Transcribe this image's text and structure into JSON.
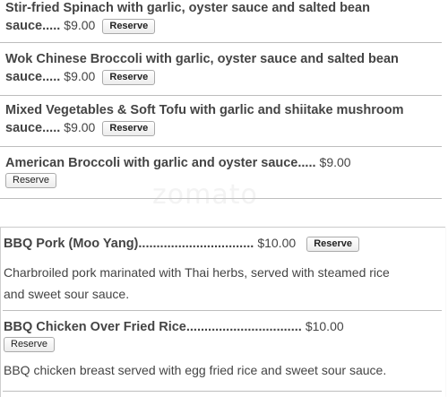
{
  "watermark": "zomato",
  "top_items": [
    {
      "name_line1": "Stir-fried Spinach with garlic, oyster sauce and salted bean",
      "name_line2": "sauce.....",
      "price": "$9.00",
      "reserve_label": "Reserve"
    },
    {
      "name_line1": "Wok Chinese Broccoli with garlic, oyster sauce and salted bean",
      "name_line2": "sauce.....",
      "price": "$9.00",
      "reserve_label": "Reserve"
    },
    {
      "name_line1": "Mixed Vegetables & Soft Tofu with garlic and shiitake mushroom",
      "name_line2": "sauce.....",
      "price": "$9.00",
      "reserve_label": "Reserve"
    },
    {
      "name_line1": "American Broccoli with garlic and oyster sauce.....",
      "price": "$9.00",
      "reserve_label": "Reserve"
    }
  ],
  "bottom_items": [
    {
      "name": "BBQ Pork (Moo Yang)................................",
      "price": "$10.00",
      "reserve_label": "Reserve",
      "description_line1": "Charbroiled pork marinated with Thai herbs, served with steamed rice",
      "description_line2": "and sweet sour sauce."
    },
    {
      "name": "BBQ Chicken Over Fried Rice................................",
      "price": "$10.00",
      "reserve_label": "Reserve",
      "description_line1": "BBQ chicken breast served with egg fried rice and sweet sour sauce."
    }
  ]
}
